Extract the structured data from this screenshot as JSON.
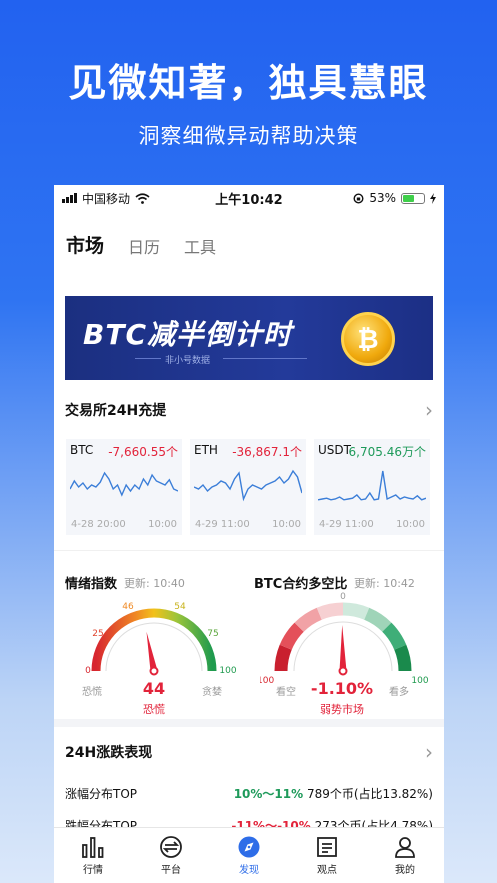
{
  "promo": {
    "title": "见微知著，独具慧眼",
    "subtitle": "洞察细微异动帮助决策"
  },
  "status": {
    "carrier": "中国移动",
    "time": "上午10:42",
    "battery": "53%",
    "battery_level": 0.53
  },
  "tabs": [
    {
      "label": "市场"
    },
    {
      "label": "日历"
    },
    {
      "label": "工具"
    }
  ],
  "banner": {
    "title": "BTC减半倒计时",
    "subtitle": "非小号数据",
    "coin_symbol": "₿"
  },
  "exchange": {
    "title": "交易所24H充提",
    "cards": [
      {
        "name": "BTC",
        "value": "-7,660.55个",
        "value_color": "#e2233a",
        "start": "4-28 20:00",
        "end": "10:00",
        "series": [
          0.55,
          0.35,
          0.5,
          0.4,
          0.55,
          0.45,
          0.5,
          0.38,
          0.15,
          0.3,
          0.55,
          0.45,
          0.7,
          0.45,
          0.6,
          0.45,
          0.55,
          0.3,
          0.45,
          0.2,
          0.35,
          0.4,
          0.45,
          0.32,
          0.55,
          0.6
        ]
      },
      {
        "name": "ETH",
        "value": "-36,867.1个",
        "value_color": "#e2233a",
        "start": "4-29 11:00",
        "end": "10:00",
        "series": [
          0.5,
          0.55,
          0.45,
          0.6,
          0.5,
          0.45,
          0.35,
          0.4,
          0.55,
          0.3,
          0.15,
          0.8,
          0.55,
          0.45,
          0.5,
          0.55,
          0.45,
          0.4,
          0.35,
          0.25,
          0.4,
          0.3,
          0.1,
          0.25,
          0.65
        ]
      },
      {
        "name": "USDT",
        "value": "6,705.46万个",
        "value_color": "#1e9a5a",
        "start": "4-29 11:00",
        "end": "10:00",
        "series": [
          0.82,
          0.8,
          0.78,
          0.82,
          0.8,
          0.75,
          0.82,
          0.8,
          0.78,
          0.7,
          0.82,
          0.8,
          0.65,
          0.82,
          0.8,
          0.1,
          0.8,
          0.75,
          0.7,
          0.8,
          0.75,
          0.78,
          0.8,
          0.72,
          0.82,
          0.78
        ]
      }
    ]
  },
  "sentiment": {
    "title": "情绪指数",
    "updated": "更新: 10:40",
    "value": 44,
    "value_text": "44",
    "state": "恐慌",
    "left_label": "恐慌",
    "right_label": "贪婪",
    "ticks": [
      "0",
      "25",
      "46",
      "54",
      "75",
      "100"
    ]
  },
  "longshort": {
    "title": "BTC合约多空比",
    "updated": "更新: 10:42",
    "value_text": "-1.10%",
    "value": -1.1,
    "state": "弱势市场",
    "left_label": "看空",
    "right_label": "看多",
    "ticks": [
      "-100",
      "0",
      "100"
    ]
  },
  "rise": {
    "title": "24H涨跌表现",
    "rows": [
      {
        "label": "涨幅分布TOP",
        "range": "10%～11%",
        "count": "789个币(占比13.82%)",
        "color": "#1e9a5a"
      },
      {
        "label": "跌幅分布TOP",
        "range": "-11%～-10%",
        "count": "273个币(占比4.78%)",
        "color": "#e2233a"
      }
    ]
  },
  "nav": [
    {
      "label": "行情",
      "icon": "bar-chart-icon"
    },
    {
      "label": "平台",
      "icon": "exchange-icon"
    },
    {
      "label": "发现",
      "icon": "compass-icon",
      "active": true
    },
    {
      "label": "观点",
      "icon": "news-icon"
    },
    {
      "label": "我的",
      "icon": "person-icon"
    }
  ],
  "colors": {
    "accent": "#2e6de8",
    "up": "#1e9a5a",
    "down": "#e2233a",
    "chart_line": "#3b7ed8"
  }
}
